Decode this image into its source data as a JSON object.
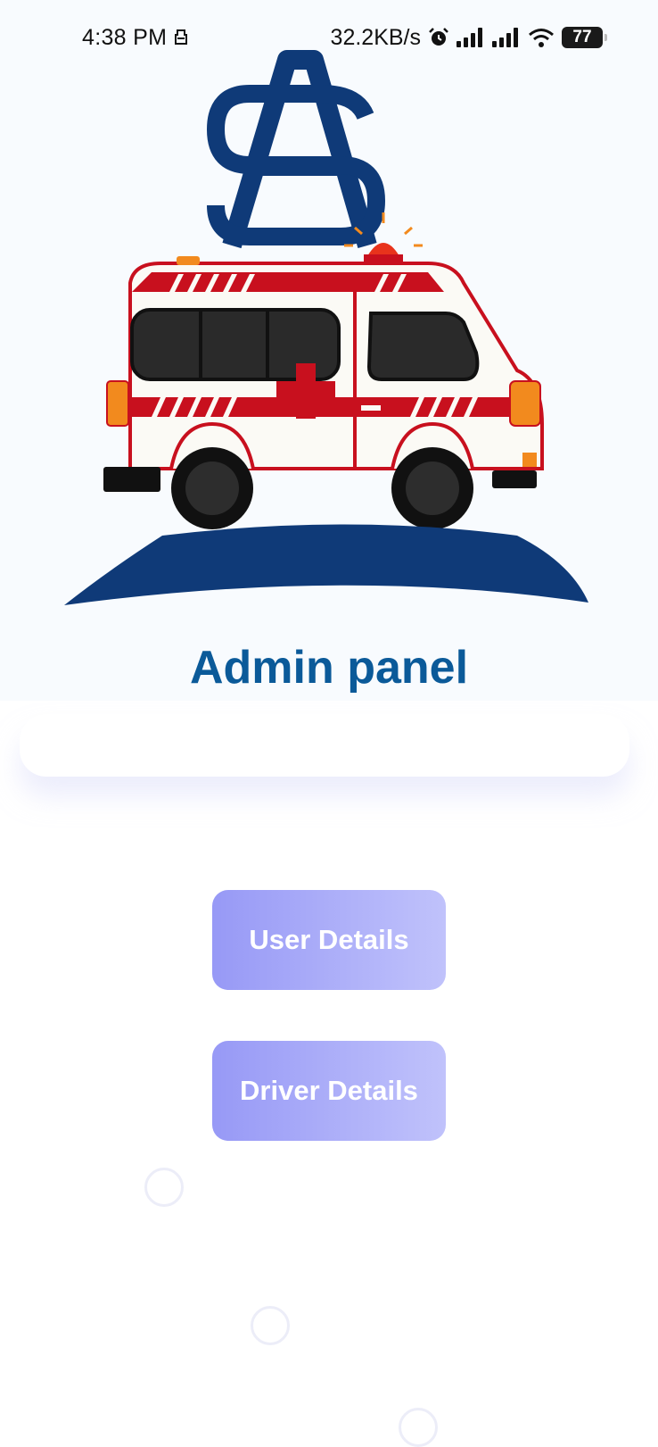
{
  "status_bar": {
    "time": "4:38 PM",
    "network_speed": "32.2KB/s",
    "battery": "77",
    "icons": [
      "sim-card-icon",
      "alarm-icon",
      "signal-icon",
      "signal-icon",
      "wifi-icon",
      "battery-icon"
    ]
  },
  "logo": {
    "monogram": "SA",
    "description_icon": "ambulance-icon",
    "colors": {
      "navy": "#0f3a78",
      "red": "#c8101e",
      "orange": "#f28a1e",
      "window": "#2a2a2a",
      "body": "#fbfaf5"
    }
  },
  "header": {
    "title": "Admin panel"
  },
  "search": {
    "value": "",
    "placeholder": ""
  },
  "buttons": {
    "user_details": "User Details",
    "driver_details": "Driver Details"
  },
  "colors": {
    "title": "#0b5a99",
    "button_gradient_start": "#9799f6",
    "button_gradient_end": "#c0c2fb",
    "background": "#ffffff"
  }
}
